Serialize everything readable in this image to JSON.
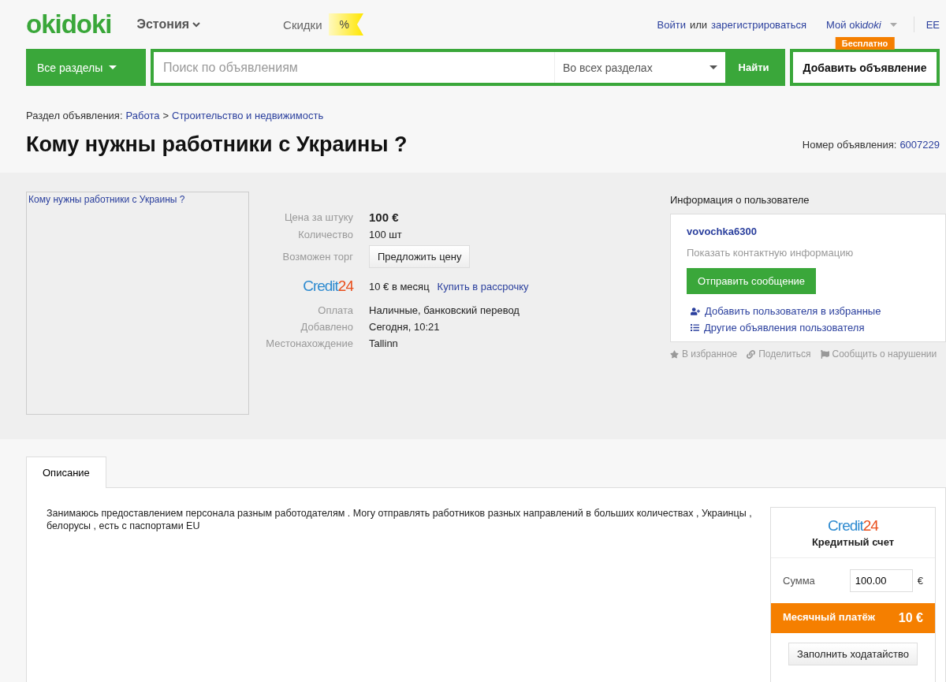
{
  "header": {
    "logo": "okidoki",
    "country": "Эстония",
    "discounts": "Скидки",
    "discount_badge": "%",
    "login": "Войти",
    "or": "или",
    "register": "зарегистрироваться",
    "my_account_prefix": "Мой oki",
    "my_account_suffix": "doki",
    "language": "EE"
  },
  "search_bar": {
    "categories": "Все разделы",
    "placeholder": "Поиск по объявлениям",
    "scope": "Во всех разделах",
    "search_button": "Найти",
    "add_button": "Добавить объявление",
    "add_badge": "Бесплатно"
  },
  "breadcrumb": {
    "label": "Раздел объявления:",
    "items": [
      "Работа",
      "Строительство и недвижимость"
    ],
    "separator": ">"
  },
  "title": "Кому нужны работники с Украины ?",
  "ad_number": {
    "label": "Номер объявления:",
    "value": "6007229"
  },
  "image_alt": "Кому нужны работники с Украины ?",
  "details": [
    {
      "kind": "price",
      "label": "Цена за штуку",
      "value": "100 €"
    },
    {
      "kind": "text",
      "label": "Количество",
      "value": "100 шт"
    },
    {
      "kind": "button",
      "label": "Возможен торг",
      "value": "Предложить цену"
    },
    {
      "kind": "credit",
      "logo_word": "Credit",
      "logo_number": "24",
      "value": "10 € в месяц",
      "link": "Купить в рассрочку"
    },
    {
      "kind": "text",
      "label": "Оплата",
      "value": "Наличные, банковский перевод"
    },
    {
      "kind": "text",
      "label": "Добавлено",
      "value": "Сегодня, 10:21"
    },
    {
      "kind": "text",
      "label": "Местонахождение",
      "value": "Tallinn"
    }
  ],
  "user": {
    "heading": "Информация о пользователе",
    "name": "vovochka6300",
    "show_contact": "Показать контактную информацию",
    "message_button": "Отправить сообщение",
    "add_favorite": "Добавить пользователя в избранные",
    "other_ads": "Другие объявления пользователя"
  },
  "actions": [
    "В избранное",
    "Поделиться",
    "Сообщить о нарушении"
  ],
  "tabs": [
    {
      "label": "Описание",
      "selected": true
    }
  ],
  "description": "Занимаюсь предоставлением персонала разным работодателям . Могу отправлять работников разных направлений в больших количествах , Украинцы , белорусы , есть с паспортами EU",
  "credit_box": {
    "logo_word": "Credit",
    "logo_number": "24",
    "title": "Кредитный счет",
    "amount_label": "Сумма",
    "amount": "100.00",
    "currency": "€",
    "monthly_label": "Месячный платёж",
    "monthly_value": "10 €",
    "apply_button": "Заполнить ходатайство"
  }
}
